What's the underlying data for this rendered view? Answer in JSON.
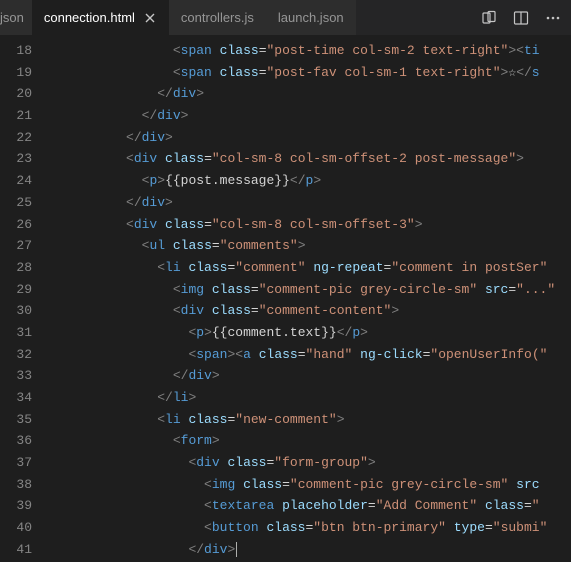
{
  "tabs": {
    "left_partial": "json",
    "active": "connection.html",
    "t2": "controllers.js",
    "t3": "launch.json"
  },
  "gutter": [
    "18",
    "19",
    "20",
    "21",
    "22",
    "23",
    "24",
    "25",
    "26",
    "27",
    "28",
    "29",
    "30",
    "31",
    "32",
    "33",
    "34",
    "35",
    "36",
    "37",
    "38",
    "39",
    "40",
    "41"
  ],
  "code": {
    "l18": {
      "indent": "                ",
      "tag": "span",
      "attrs": [
        [
          "class",
          "post-time col-sm-2 text-right"
        ]
      ],
      "tail_open_lt": true,
      "tail_tag": "ti"
    },
    "l19": {
      "indent": "                ",
      "tag": "span",
      "attrs": [
        [
          "class",
          "post-fav col-sm-1 text-right"
        ]
      ],
      "trail_text": "☆",
      "close_tag": "s"
    },
    "l20": {
      "indent": "              ",
      "close": "div"
    },
    "l21": {
      "indent": "            ",
      "close": "div"
    },
    "l22": {
      "indent": "          ",
      "close": "div"
    },
    "l23": {
      "indent": "          ",
      "tag": "div",
      "attrs": [
        [
          "class",
          "col-sm-8 col-sm-offset-2 post-message"
        ]
      ],
      "end_gt": true
    },
    "l24": {
      "indent": "            ",
      "tag": "p",
      "inner": "{{post.message}}",
      "close": "p"
    },
    "l25": {
      "indent": "          ",
      "close": "div"
    },
    "l26": {
      "indent": "          ",
      "tag": "div",
      "attrs": [
        [
          "class",
          "col-sm-8 col-sm-offset-3"
        ]
      ],
      "end_gt": true
    },
    "l27": {
      "indent": "            ",
      "tag": "ul",
      "attrs": [
        [
          "class",
          "comments"
        ]
      ],
      "end_gt": true
    },
    "l28": {
      "indent": "              ",
      "tag": "li",
      "attrs": [
        [
          "class",
          "comment"
        ],
        [
          "ng-repeat",
          "comment in postSer"
        ]
      ],
      "cut": true
    },
    "l29": {
      "indent": "                ",
      "tag": "img",
      "attrs": [
        [
          "class",
          "comment-pic grey-circle-sm"
        ],
        [
          "src",
          "..."
        ]
      ],
      "cut": true
    },
    "l30": {
      "indent": "                ",
      "tag": "div",
      "attrs": [
        [
          "class",
          "comment-content"
        ]
      ],
      "end_gt": true
    },
    "l31": {
      "indent": "                  ",
      "tag": "p",
      "inner": "{{comment.text}}",
      "close": "p"
    },
    "l32": {
      "indent": "                  ",
      "tag": "span",
      "end_gt": true,
      "then_open": "a",
      "then_attrs": [
        [
          "class",
          "hand"
        ],
        [
          "ng-click",
          "openUserInfo("
        ]
      ],
      "cut": true
    },
    "l33": {
      "indent": "                ",
      "close": "div"
    },
    "l34": {
      "indent": "              ",
      "close": "li"
    },
    "l35": {
      "indent": "              ",
      "tag": "li",
      "attrs": [
        [
          "class",
          "new-comment"
        ]
      ],
      "end_gt": true
    },
    "l36": {
      "indent": "                ",
      "tag": "form",
      "end_gt": true
    },
    "l37": {
      "indent": "                  ",
      "tag": "div",
      "attrs": [
        [
          "class",
          "form-group"
        ]
      ],
      "end_gt": true
    },
    "l38": {
      "indent": "                    ",
      "tag": "img",
      "attrs": [
        [
          "class",
          "comment-pic grey-circle-sm"
        ]
      ],
      "trail_attr": "src",
      "cut": true
    },
    "l39": {
      "indent": "                    ",
      "tag": "textarea",
      "attrs": [
        [
          "placeholder",
          "Add Comment"
        ]
      ],
      "trail_attr": "class",
      "trail_eq": true,
      "cut": true
    },
    "l40": {
      "indent": "                    ",
      "tag": "button",
      "attrs": [
        [
          "class",
          "btn btn-primary"
        ],
        [
          "type",
          "submi"
        ]
      ],
      "cut": true
    },
    "l41": {
      "indent": "                  ",
      "close": "div",
      "cursor": true
    }
  }
}
